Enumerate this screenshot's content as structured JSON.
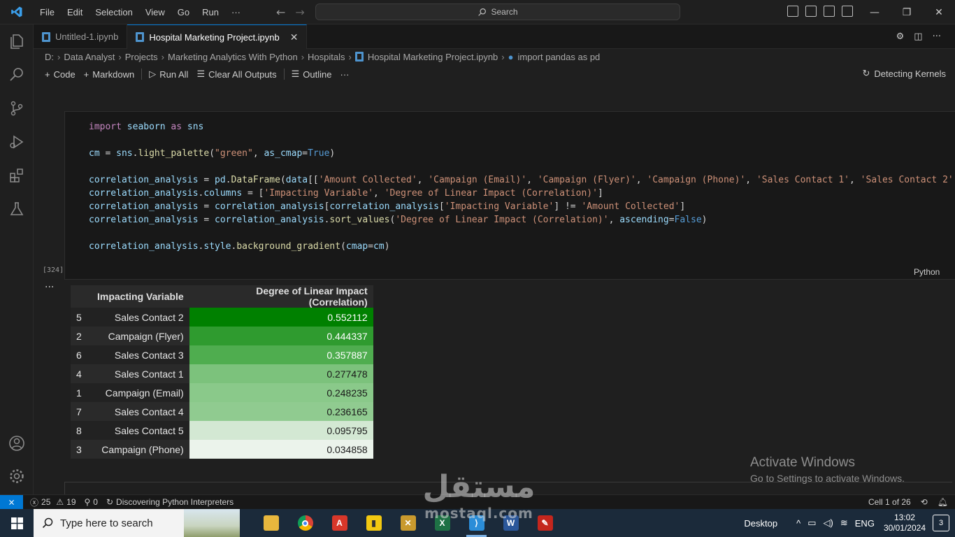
{
  "titlebar": {
    "menu": [
      "File",
      "Edit",
      "Selection",
      "View",
      "Go",
      "Run",
      "···"
    ],
    "search_placeholder": "Search"
  },
  "tabs": [
    {
      "label": "Untitled-1.ipynb",
      "active": false
    },
    {
      "label": "Hospital Marketing Project.ipynb",
      "active": true
    }
  ],
  "breadcrumb": [
    "D:",
    "Data Analyst",
    "Projects",
    "Marketing Analytics With Python",
    "Hospitals",
    "Hospital Marketing Project.ipynb",
    "import pandas as pd"
  ],
  "toolbar": {
    "code": "Code",
    "markdown": "Markdown",
    "run_all": "Run All",
    "clear_outputs": "Clear All Outputs",
    "outline": "Outline",
    "more": "···",
    "kernel_status": "Detecting Kernels"
  },
  "cell": {
    "exec_count": "[324]",
    "language": "Python",
    "output_menu": "···"
  },
  "output_table": {
    "headers": [
      "Impacting Variable",
      "Degree of Linear Impact (Correlation)"
    ],
    "rows": [
      {
        "index": "5",
        "variable": "Sales Contact 2",
        "value": "0.552112",
        "color": "#008000",
        "text": "#ffffff"
      },
      {
        "index": "2",
        "variable": "Campaign (Flyer)",
        "value": "0.444337",
        "color": "#2f9b2f",
        "text": "#ffffff"
      },
      {
        "index": "6",
        "variable": "Sales Contact 3",
        "value": "0.357887",
        "color": "#4fad4f",
        "text": "#ffffff"
      },
      {
        "index": "4",
        "variable": "Sales Contact 1",
        "value": "0.277478",
        "color": "#7cc27c",
        "text": "#1a1a1a"
      },
      {
        "index": "1",
        "variable": "Campaign (Email)",
        "value": "0.248235",
        "color": "#8ac98a",
        "text": "#1a1a1a"
      },
      {
        "index": "7",
        "variable": "Sales Contact 4",
        "value": "0.236165",
        "color": "#90cb90",
        "text": "#1a1a1a"
      },
      {
        "index": "8",
        "variable": "Sales Contact 5",
        "value": "0.095795",
        "color": "#d3e8d3",
        "text": "#1a1a1a"
      },
      {
        "index": "3",
        "variable": "Campaign (Phone)",
        "value": "0.034858",
        "color": "#ebf3eb",
        "text": "#1a1a1a"
      }
    ]
  },
  "activate_windows": {
    "title": "Activate Windows",
    "subtitle": "Go to Settings to activate Windows."
  },
  "statusbar": {
    "errors": "25",
    "warnings": "19",
    "ports": "0",
    "status": "Discovering Python Interpreters",
    "cell_position": "Cell 1 of 26"
  },
  "taskbar": {
    "search_placeholder": "Type here to search",
    "desktop": "Desktop",
    "language": "ENG",
    "time": "13:02",
    "date": "30/01/2024",
    "notifications": "3"
  },
  "watermark": {
    "arabic": "مستقل",
    "latin": "mostaql.com"
  }
}
